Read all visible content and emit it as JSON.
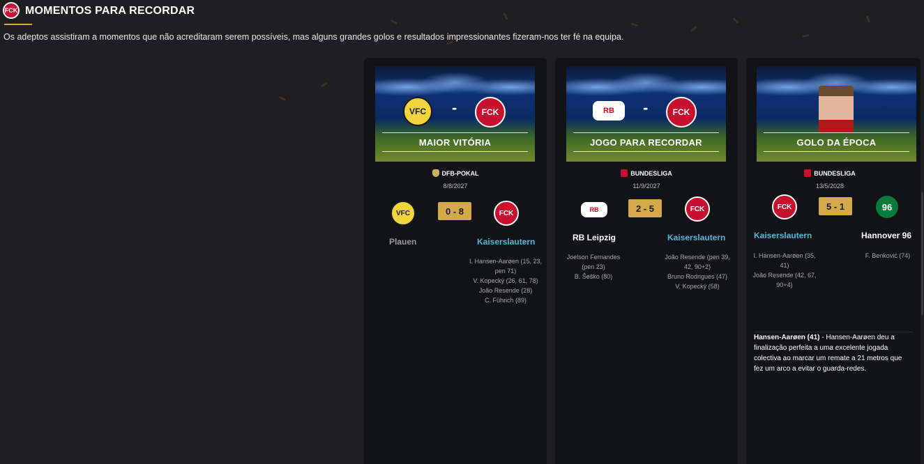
{
  "header": {
    "logo_text": "FCK",
    "title": "MOMENTOS PARA RECORDAR",
    "subtitle": "Os adeptos assistiram a momentos que não acreditaram serem possíveis, mas alguns grandes golos e resultados impressionantes fizeram-nos ter fé na equipa."
  },
  "cards": [
    {
      "banner_label": "MAIOR VITÓRIA",
      "competition": "DFB-POKAL",
      "date": "8/8/2027",
      "score": "0 - 8",
      "home": {
        "name": "Plauen",
        "crest_text": "VFC",
        "scorers": []
      },
      "away": {
        "name": "Kaiserslautern",
        "crest_text": "FCK",
        "scorers": [
          "I. Hansen-Aarøen (15, 23, pen 71)",
          "V. Kopecký (26, 61, 78)",
          "João Resende (28)",
          "C. Führich (89)"
        ]
      }
    },
    {
      "banner_label": "JOGO PARA RECORDAR",
      "competition": "BUNDESLIGA",
      "date": "11/9/2027",
      "score": "2 - 5",
      "home": {
        "name": "RB Leipzig",
        "crest_text": "RB",
        "scorers": [
          "Joelson Fernandes (pen 23)",
          "B. Šeško (80)"
        ]
      },
      "away": {
        "name": "Kaiserslautern",
        "crest_text": "FCK",
        "scorers": [
          "João Resende (pen 39, 42, 90+2)",
          "Bruno Rodrigues (47)",
          "V. Kopecký (58)"
        ]
      }
    },
    {
      "banner_label": "GOLO DA ÉPOCA",
      "competition": "BUNDESLIGA",
      "date": "13/5/2028",
      "score": "5 - 1",
      "home": {
        "name": "Kaiserslautern",
        "crest_text": "FCK",
        "scorers": [
          "I. Hansen-Aarøen (35, 41)",
          "João Resende (42, 67, 90+4)"
        ]
      },
      "away": {
        "name": "Hannover 96",
        "crest_text": "96",
        "scorers": [
          "F. Benković (74)"
        ]
      },
      "description_author": "Hansen-Aarøen (41)",
      "description_text": " - Hansen-Aarøen deu a finalização perfeita a uma excelente jogada colectiva ao marcar um remate a 21 metros que fez um arco a evitar o guarda-redes."
    }
  ],
  "colors": {
    "accent": "#d3a94a",
    "winner": "#51b3d6",
    "background": "#1f1f22",
    "card": "#121316"
  },
  "icons": [
    "club-crest-icon",
    "dfb-pokal-icon",
    "bundesliga-icon"
  ]
}
